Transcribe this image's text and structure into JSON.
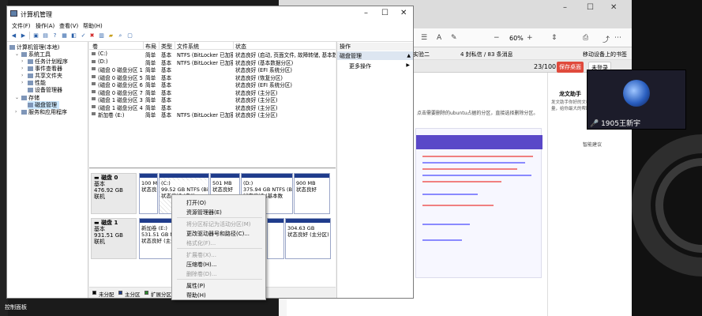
{
  "desktop": {
    "label": "控制面板"
  },
  "video": {
    "name": "1905王新宇"
  },
  "browser": {
    "zoom": "60%",
    "bookmarks": [
      "实验二",
      "4 封私信 / 83 条消息",
      "移动设备上的书签"
    ],
    "page_indicator": "23/100",
    "btn_save": "保存桌面",
    "btn_user": "未登录",
    "content_text": "点击需要删除的ubuntu占据的分区，直接选择删除分区。",
    "side_title": "龙文助手",
    "side_sub": [
      "发文助手你好的文档",
      "量，给你最大的帮助"
    ],
    "side_bottom": "智能建议"
  },
  "window": {
    "title": "计算机管理",
    "menu": [
      "文件(F)",
      "操作(A)",
      "查看(V)",
      "帮助(H)"
    ],
    "tree": {
      "root": "计算机管理(本地)",
      "system_tools": "系统工具",
      "task_scheduler": "任务计划程序",
      "event_viewer": "事件查看器",
      "shared_folders": "共享文件夹",
      "performance": "性能",
      "device_manager": "设备管理器",
      "storage": "存储",
      "disk_management": "磁盘管理",
      "services_apps": "服务和应用程序"
    },
    "columns": [
      "卷",
      "布局",
      "类型",
      "文件系统",
      "状态"
    ],
    "volumes": [
      {
        "vol": "(C:)",
        "layout": "简单",
        "type": "基本",
        "fs": "NTFS (BitLocker 已加密)",
        "status": "状态良好 (启动, 页面文件, 故障转储, 基本数据分区)"
      },
      {
        "vol": "(D:)",
        "layout": "简单",
        "type": "基本",
        "fs": "NTFS (BitLocker 已加密)",
        "status": "状态良好 (基本数据分区)"
      },
      {
        "vol": "(磁盘 0 磁盘分区 1)",
        "layout": "简单",
        "type": "基本",
        "fs": "",
        "status": "状态良好 (EFI 系统分区)"
      },
      {
        "vol": "(磁盘 0 磁盘分区 5)",
        "layout": "简单",
        "type": "基本",
        "fs": "",
        "status": "状态良好 (恢复分区)"
      },
      {
        "vol": "(磁盘 0 磁盘分区 6)",
        "layout": "简单",
        "type": "基本",
        "fs": "",
        "status": "状态良好 (EFI 系统分区)"
      },
      {
        "vol": "(磁盘 0 磁盘分区 7)",
        "layout": "简单",
        "type": "基本",
        "fs": "",
        "status": "状态良好 (主分区)"
      },
      {
        "vol": "(磁盘 1 磁盘分区 3)",
        "layout": "简单",
        "type": "基本",
        "fs": "",
        "status": "状态良好 (主分区)"
      },
      {
        "vol": "(磁盘 1 磁盘分区 4)",
        "layout": "简单",
        "type": "基本",
        "fs": "",
        "status": "状态良好 (主分区)"
      },
      {
        "vol": "新加卷 (E:)",
        "layout": "简单",
        "type": "基本",
        "fs": "NTFS (BitLocker 已加密)",
        "status": "状态良好 (主分区)"
      }
    ],
    "disk0": {
      "name": "磁盘 0",
      "type": "基本",
      "size": "476.92 GB",
      "status": "联机",
      "parts": [
        {
          "l1": "",
          "l2": "100 M",
          "l3": "状态良"
        },
        {
          "l1": "(C:)",
          "l2": "99.52 GB NTFS (BitL",
          "l3": "状态良好 (启动"
        },
        {
          "l1": "",
          "l2": "501 MB",
          "l3": "状态良好"
        },
        {
          "l1": "(D:)",
          "l2": "375.94 GB NTFS (BitL",
          "l3": "状态良好 (基本数"
        },
        {
          "l1": "",
          "l2": "900 MB",
          "l3": "状态良好"
        }
      ]
    },
    "disk1": {
      "name": "磁盘 1",
      "type": "基本",
      "size": "931.51 GB",
      "status": "联机",
      "parts": [
        {
          "l1": "新加卷 (E:)",
          "l2": "531.51 GB NTFS",
          "l3": "状态良好 (主分"
        },
        {
          "l1": "",
          "l2": "",
          "l3": ""
        },
        {
          "l1": "",
          "l2": "304.63 GB",
          "l3": "状态良好 (主分区)"
        }
      ]
    },
    "legend": [
      {
        "label": "未分配",
        "color": "#000000"
      },
      {
        "label": "主分区",
        "color": "#1f3c8c"
      },
      {
        "label": "扩展分区",
        "color": "#2e8b2e"
      }
    ],
    "actions": {
      "header": "操作",
      "section": "磁盘管理",
      "more": "更多操作"
    },
    "context_menu": [
      {
        "label": "打开(O)",
        "enabled": true
      },
      {
        "label": "资源管理器(E)",
        "enabled": true
      },
      {
        "label": "将分区标记为活动分区(M)",
        "enabled": false
      },
      {
        "label": "更改驱动器号和路径(C)...",
        "enabled": true
      },
      {
        "label": "格式化(F)...",
        "enabled": false
      },
      {
        "label": "扩展卷(X)...",
        "enabled": false
      },
      {
        "label": "压缩卷(H)...",
        "enabled": true
      },
      {
        "label": "删除卷(D)...",
        "enabled": false
      },
      {
        "label": "属性(P)",
        "enabled": true
      },
      {
        "label": "帮助(H)",
        "enabled": true
      }
    ]
  }
}
